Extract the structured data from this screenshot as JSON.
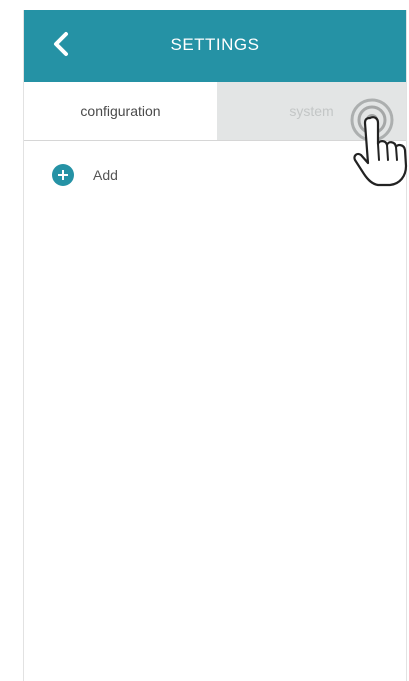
{
  "header": {
    "title": "SETTINGS",
    "back_icon": "chevron-left-icon",
    "background_color": "#2592a5"
  },
  "tabs": [
    {
      "label": "configuration",
      "active": true
    },
    {
      "label": "system",
      "active": false
    }
  ],
  "list": {
    "add_label": "Add",
    "add_icon": "plus-circle-icon"
  },
  "gesture": {
    "icon": "tap-hand-icon",
    "target": "system"
  },
  "colors": {
    "accent": "#2592a5",
    "inactive_tab_bg": "#e3e5e5"
  }
}
